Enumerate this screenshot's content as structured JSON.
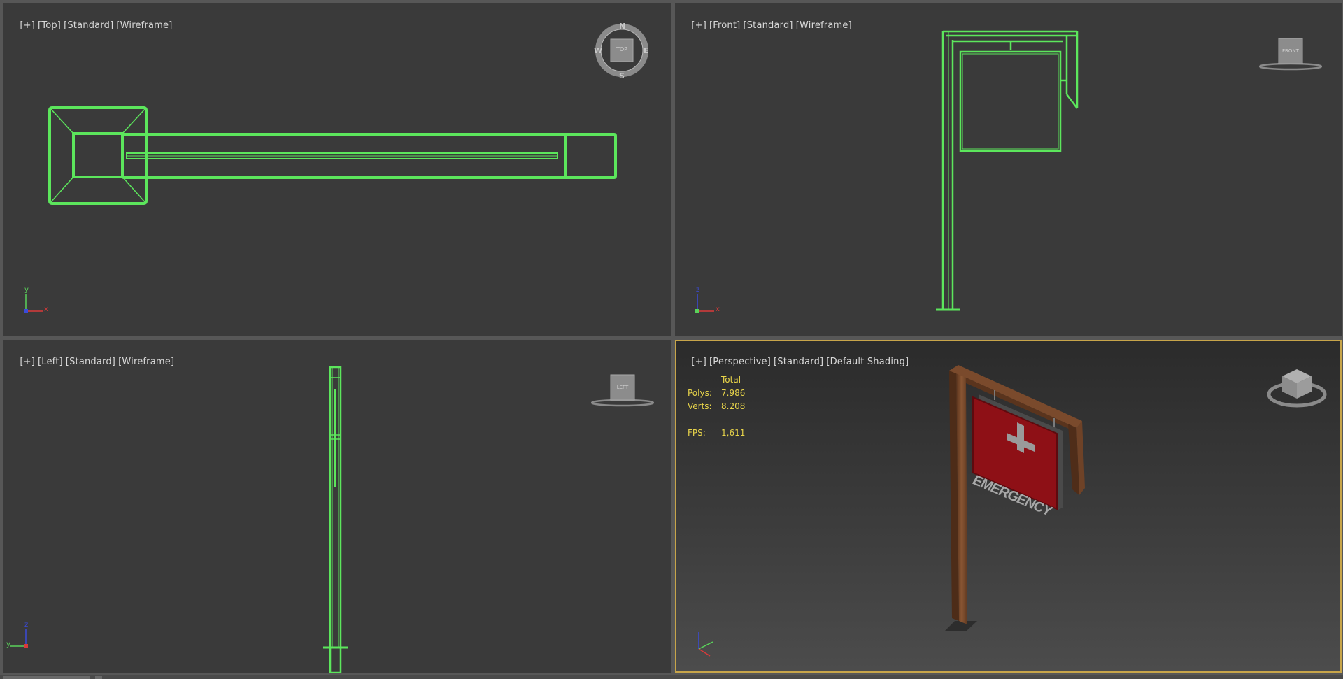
{
  "viewports": {
    "top": {
      "label": [
        "[+]",
        "[Top]",
        "[Standard]",
        "[Wireframe]"
      ],
      "compass": {
        "n": "N",
        "s": "S",
        "e": "E",
        "w": "W",
        "cube": "TOP"
      },
      "axis": {
        "y": "y",
        "x": "x"
      }
    },
    "front": {
      "label": [
        "[+]",
        "[Front]",
        "[Standard]",
        "[Wireframe]"
      ],
      "cube": "FRONT",
      "axis": {
        "z": "z",
        "x": "x"
      }
    },
    "left": {
      "label": [
        "[+]",
        "[Left]",
        "[Standard]",
        "[Wireframe]"
      ],
      "cube": "LEFT",
      "axis": {
        "z": "z",
        "y": "y"
      }
    },
    "perspective": {
      "label": [
        "[+]",
        "[Perspective]",
        "[Standard]",
        "[Default Shading]"
      ],
      "stats": {
        "header": "Total",
        "polys_label": "Polys:",
        "polys": "7.986",
        "verts_label": "Verts:",
        "verts": "8.208",
        "fps_label": "FPS:",
        "fps": "1,611"
      },
      "sign_text": "EMERGENCY",
      "colors": {
        "sign_red": "#8e1016",
        "wood": "#7a4a2c",
        "wireframe": "#5ce65c",
        "active_border": "#c7a54a",
        "stats_text": "#e9d54a"
      }
    }
  }
}
